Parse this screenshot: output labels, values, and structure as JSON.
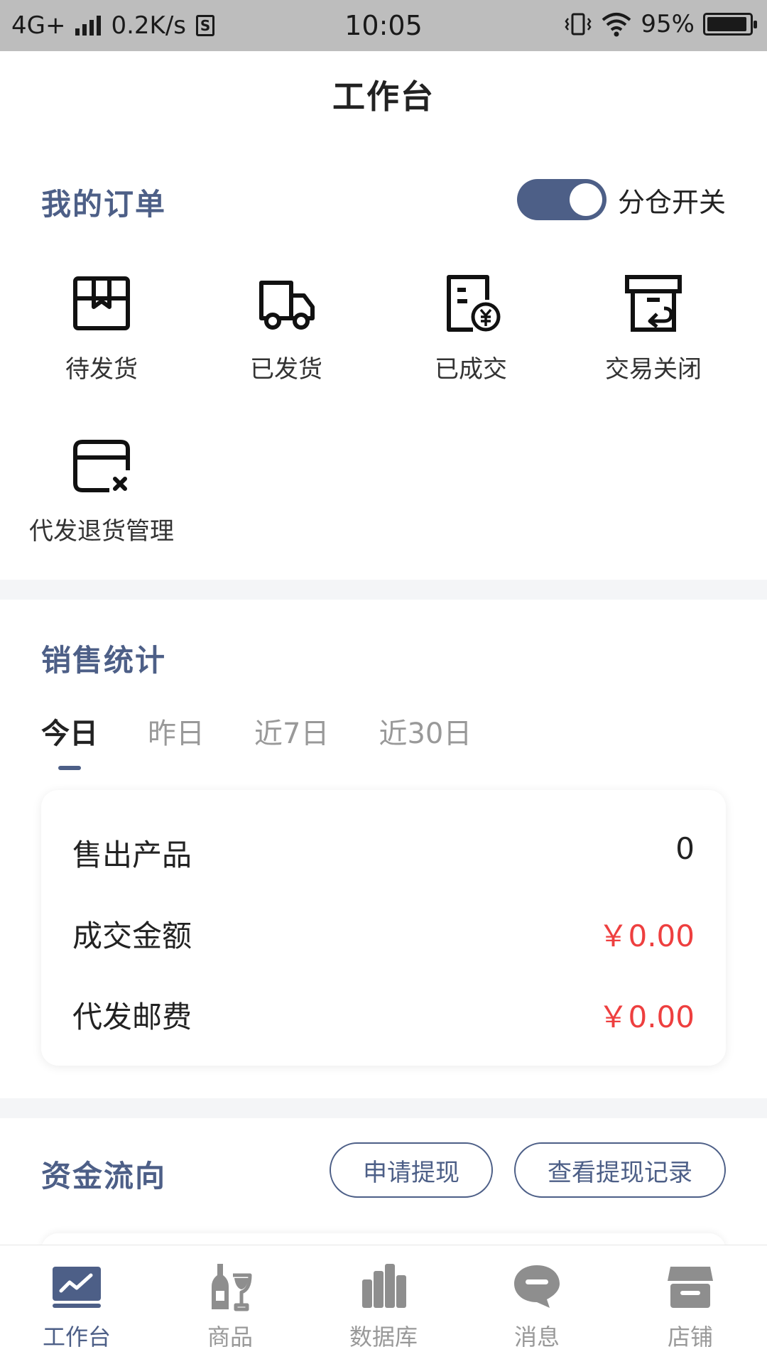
{
  "status_bar": {
    "network": "4G+",
    "speed": "0.2K/s",
    "sim_icon": "S",
    "time": "10:05",
    "battery": "95%",
    "battery_level": 95
  },
  "header": {
    "title": "工作台"
  },
  "orders": {
    "title": "我的订单",
    "toggle_label": "分仓开关",
    "toggle_on": true,
    "items": [
      {
        "label": "待发货",
        "icon": "package-icon"
      },
      {
        "label": "已发货",
        "icon": "truck-icon"
      },
      {
        "label": "已成交",
        "icon": "invoice-yuan-icon"
      },
      {
        "label": "交易关闭",
        "icon": "box-return-icon"
      },
      {
        "label": "代发退货管理",
        "icon": "card-cancel-icon"
      }
    ]
  },
  "sales": {
    "title": "销售统计",
    "tabs": [
      "今日",
      "昨日",
      "近7日",
      "近30日"
    ],
    "active_tab": 0,
    "rows": [
      {
        "label": "售出产品",
        "value": "0"
      },
      {
        "label": "成交金额",
        "value": "￥0.00"
      },
      {
        "label": "代发邮费",
        "value": "￥0.00"
      }
    ]
  },
  "funds": {
    "title": "资金流向",
    "withdraw_button": "申请提现",
    "records_button": "查看提现记录"
  },
  "nav": {
    "items": [
      {
        "label": "工作台",
        "icon": "dashboard-chart-icon"
      },
      {
        "label": "商品",
        "icon": "wine-bottle-glass-icon"
      },
      {
        "label": "数据库",
        "icon": "database-bars-icon"
      },
      {
        "label": "消息",
        "icon": "message-bubble-icon"
      },
      {
        "label": "店铺",
        "icon": "store-icon"
      }
    ],
    "active": 0
  },
  "colors": {
    "accent": "#4d5f87",
    "money": "#ee3f3f",
    "divider": "#f4f5f7"
  }
}
